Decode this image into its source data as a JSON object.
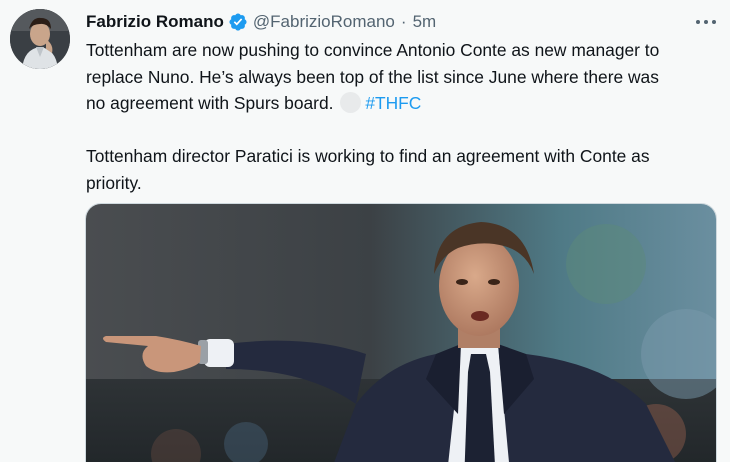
{
  "tweet": {
    "author_name": "Fabrizio Romano",
    "handle": "@FabrizioRomano",
    "separator": "·",
    "time": "5m",
    "paragraph1_line1": "Tottenham are now pushing to convince Antonio Conte as new manager to",
    "paragraph1_line2": "replace Nuno. He’s always been top of the list since June where there was",
    "paragraph1_line3": "no agreement with Spurs board.",
    "hashtag": "#THFC",
    "paragraph2_line1": "Tottenham director Paratici is working to find an agreement with Conte as",
    "paragraph2_line2": "priority."
  },
  "icons": {
    "verified": "verified-badge-icon",
    "more": "more-options-icon"
  },
  "colors": {
    "background": "#f7f9f9",
    "text": "#0f1419",
    "secondary": "#536471",
    "link": "#1d9bf0",
    "verified": "#1d9bf0"
  }
}
